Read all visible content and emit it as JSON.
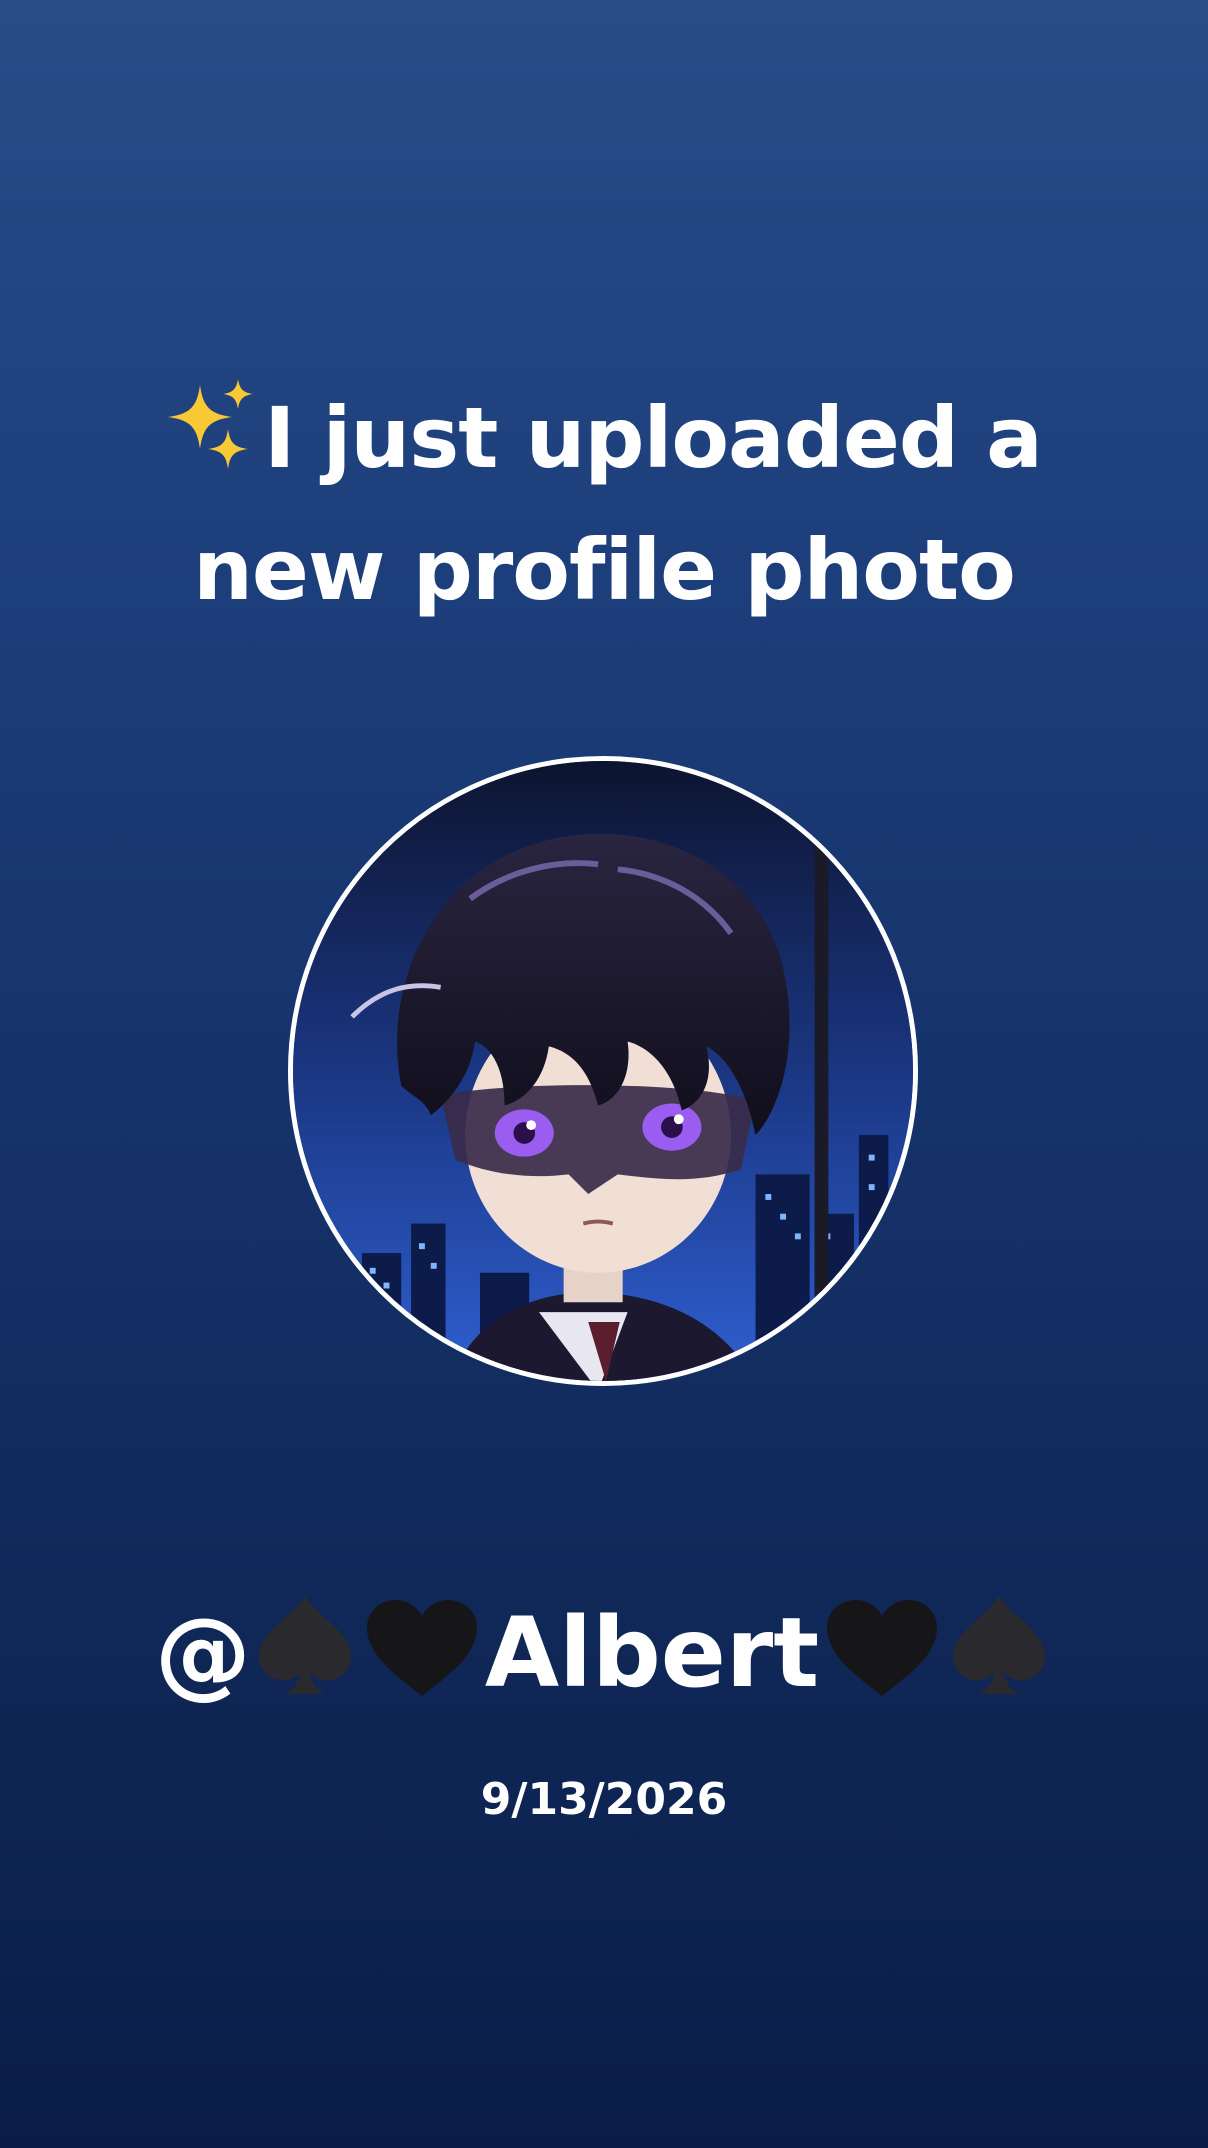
{
  "post": {
    "headline_line1": "I just uploaded a",
    "headline_line2": "new profile photo",
    "username_prefix": "@",
    "username_name": "Albert",
    "date": "9/13/2026",
    "avatar_alt": "anime boy profile photo"
  },
  "icons": {
    "sparkle": "sparkles-icon",
    "spade": "spade-icon",
    "heart": "black-heart-icon"
  },
  "colors": {
    "background_top": "#294c87",
    "background_bottom": "#0a1d48",
    "text": "#ffffff",
    "sparkle": "#f7c935"
  }
}
